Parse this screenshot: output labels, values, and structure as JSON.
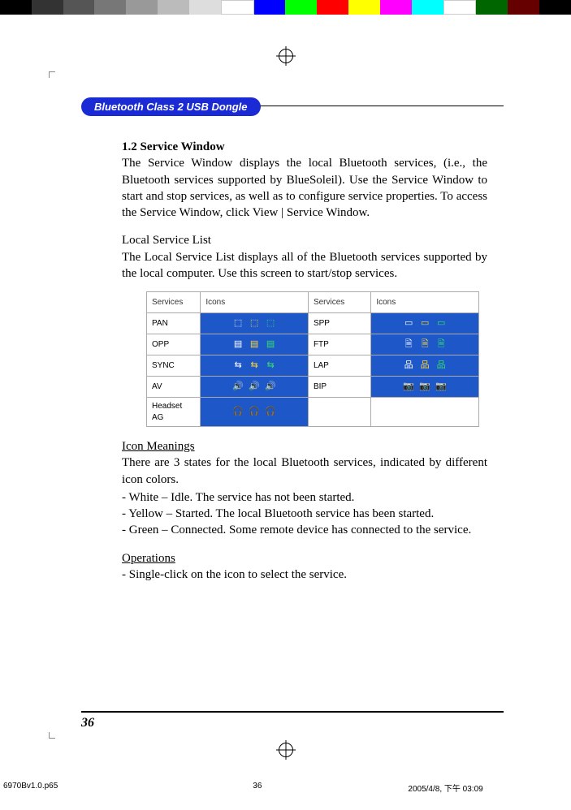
{
  "color_bar": [
    "#000000",
    "#333333",
    "#555555",
    "#777777",
    "#999999",
    "#bbbbbb",
    "#dddddd",
    "#ffffff",
    "#0000ff",
    "#00ff00",
    "#ff0000",
    "#ffff00",
    "#ff00ff",
    "#00ffff",
    "#ffffff",
    "#006600",
    "#660000",
    "#000000"
  ],
  "header": {
    "pill": "Bluetooth Class 2 USB Dongle"
  },
  "section": {
    "heading": "1.2 Service Window",
    "p1": "The Service Window displays the local Bluetooth services, (i.e., the Bluetooth services supported by BlueSoleil). Use the Service Window to start and stop services, as well as to configure service properties. To access the Service Window, click View | Service Window.",
    "sub1_title": "Local Service List",
    "sub1_body": "The Local Service List displays all of the Bluetooth services supported by the local computer. Use this screen to start/stop services.",
    "table": {
      "headers": [
        "Services",
        "Icons",
        "Services",
        "Icons"
      ],
      "rows": [
        {
          "s1": "PAN",
          "s2": "SPP"
        },
        {
          "s1": "OPP",
          "s2": "FTP"
        },
        {
          "s1": "SYNC",
          "s2": "LAP"
        },
        {
          "s1": "AV",
          "s2": "BIP"
        },
        {
          "s1": "Headset AG",
          "s2": ""
        }
      ]
    },
    "icon_meanings_title": "Icon Meanings",
    "icon_meanings_body": "There are 3 states for the local Bluetooth services, indicated by different icon colors.",
    "states": [
      "- White – Idle. The service has not been started.",
      "- Yellow – Started. The local Bluetooth service has been started.",
      "- Green – Connected. Some remote device has connected to the service."
    ],
    "operations_title": "Operations",
    "operations_body": "- Single-click on the icon to select the service."
  },
  "page_number": "36",
  "imprint": {
    "file": "6970Bv1.0.p65",
    "page": "36",
    "datetime": "2005/4/8, 下午 03:09"
  }
}
